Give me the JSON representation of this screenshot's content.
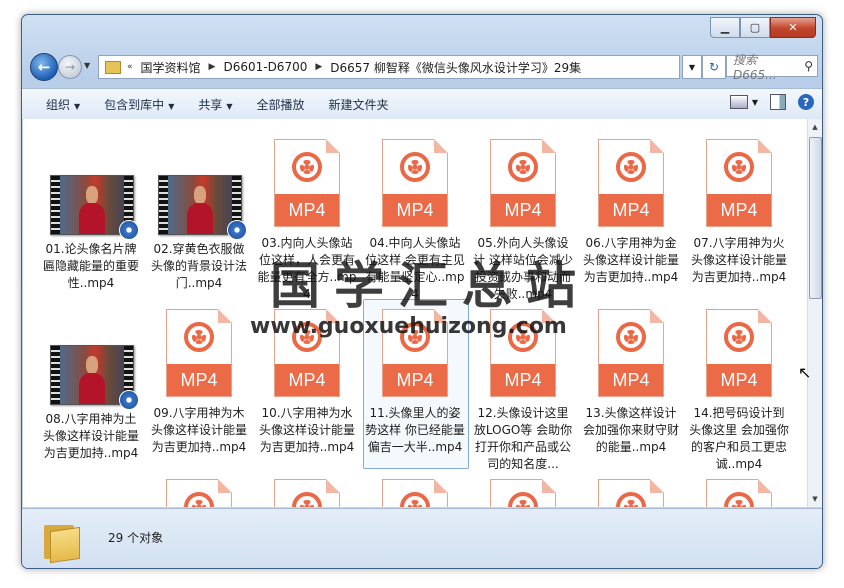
{
  "addressbar": {
    "breadcrumb": [
      "国学资料馆",
      "D6601-D6700",
      "D6657 柳智释《微信头像风水设计学习》29集"
    ],
    "search_placeholder": "搜索 D665..."
  },
  "toolbar": {
    "organize": "组织",
    "include_library": "包含到库中",
    "share": "共享",
    "play_all": "全部播放",
    "new_folder": "新建文件夹"
  },
  "files": [
    {
      "name": "01.论头像名片牌匾隐藏能量的重要性..mp4",
      "type": "video-thumb"
    },
    {
      "name": "02.穿黄色衣服做头像的背景设计法门..mp4",
      "type": "video-thumb"
    },
    {
      "name": "03.内向人头像站位这样，人会更有能量更有全方..mp4",
      "type": "mp4"
    },
    {
      "name": "04.中向人头像站位这样 会更有主见有能量坚定心..mp4",
      "type": "mp4"
    },
    {
      "name": "05.外向人头像设计 这样站位会减少投资或办事和动而失败..mp4",
      "type": "mp4"
    },
    {
      "name": "06.八字用神为金头像这样设计能量为吉更加持..mp4",
      "type": "mp4"
    },
    {
      "name": "07.八字用神为火头像这样设计能量为吉更加持..mp4",
      "type": "mp4"
    },
    {
      "name": "08.八字用神为土头像这样设计能量为吉更加持..mp4",
      "type": "video-thumb"
    },
    {
      "name": "09.八字用神为木头像这样设计能量为吉更加持..mp4",
      "type": "mp4"
    },
    {
      "name": "10.八字用神为水头像这样设计能量为吉更加持..mp4",
      "type": "mp4"
    },
    {
      "name": "11.头像里人的姿势这样 你已经能量偏吉一大半..mp4",
      "type": "mp4"
    },
    {
      "name": "12.头像设计这里放LOGO等 会助你打开你和产品或公司的知名度...",
      "type": "mp4"
    },
    {
      "name": "13.头像这样设计会加强你来财守财的能量..mp4",
      "type": "mp4"
    },
    {
      "name": "14.把号码设计到头像这里 会加强你的客户和员工更忠诚..mp4",
      "type": "mp4"
    }
  ],
  "mp4_label": "MP4",
  "watermark": {
    "title": "国学汇总站",
    "url": "www.guoxuehuizong.com"
  },
  "status": {
    "count": "29 个对象"
  },
  "colors": {
    "mp4_accent": "#eb6a47",
    "window_frame": "#b9cfe9"
  }
}
